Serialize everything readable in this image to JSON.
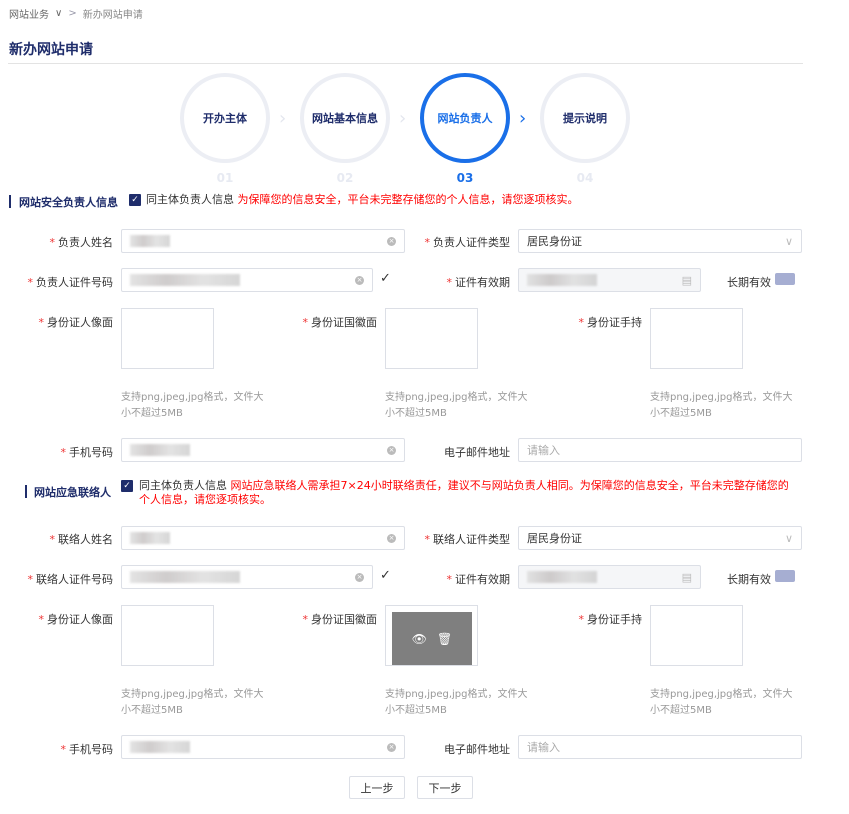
{
  "breadcrumb": {
    "parent": "网站业务",
    "current": "新办网站申请"
  },
  "page_title": "新办网站申请",
  "steps": [
    {
      "label": "开办主体",
      "num": "01"
    },
    {
      "label": "网站基本信息",
      "num": "02"
    },
    {
      "label": "网站负责人",
      "num": "03",
      "active": true
    },
    {
      "label": "提示说明",
      "num": "04"
    }
  ],
  "sections": [
    {
      "title": "网站安全负责人信息",
      "same_label": "同主体负责人信息",
      "warning": "为保障您的信息安全，平台未完整存储您的个人信息，请您逐项核实。",
      "name_label": "负责人姓名",
      "idtype_label": "负责人证件类型",
      "idtype_value": "居民身份证",
      "idno_label": "负责人证件号码",
      "validity_label": "证件有效期",
      "longterm_label": "长期有效",
      "front_label": "身份证人像面",
      "back_label": "身份证国徽面",
      "hold_label": "身份证手持",
      "upload_hint": "支持png,jpeg,jpg格式，文件大小不超过5MB",
      "phone_label": "手机号码",
      "email_label": "电子邮件地址",
      "email_placeholder": "请输入"
    },
    {
      "title": "网站应急联络人",
      "same_label": "同主体负责人信息",
      "warning": "网站应急联络人需承担7×24小时联络责任，建议不与网站负责人相同。为保障您的信息安全，平台未完整存储您的个人信息，请您逐项核实。",
      "name_label": "联络人姓名",
      "idtype_label": "联络人证件类型",
      "idtype_value": "居民身份证",
      "idno_label": "联络人证件号码",
      "validity_label": "证件有效期",
      "longterm_label": "长期有效",
      "front_label": "身份证人像面",
      "back_label": "身份证国徽面",
      "hold_label": "身份证手持",
      "upload_hint": "支持png,jpeg,jpg格式，文件大小不超过5MB",
      "phone_label": "手机号码",
      "email_label": "电子邮件地址",
      "email_placeholder": "请输入"
    }
  ],
  "buttons": {
    "prev": "上一步",
    "next": "下一步"
  },
  "colors": {
    "accent": "#1a6fe8",
    "navy": "#1f2d6b",
    "warning": "#ff0000"
  }
}
